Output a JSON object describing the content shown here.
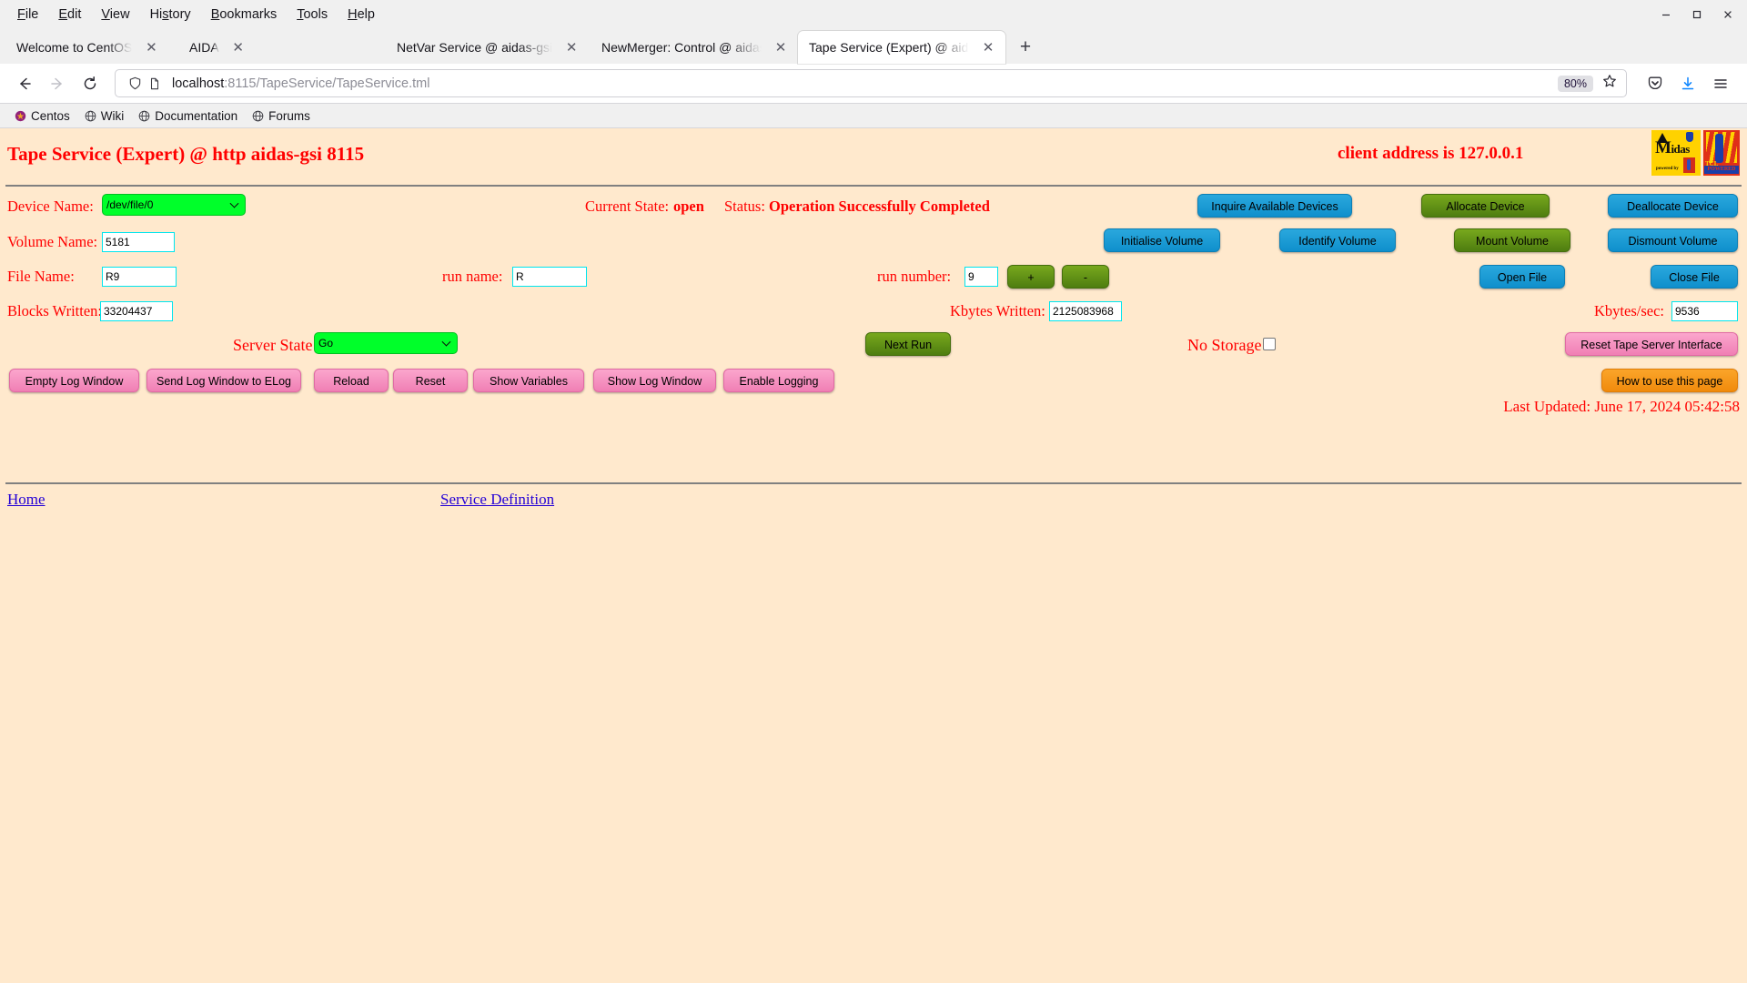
{
  "browser": {
    "menus": [
      {
        "label": "File",
        "accel": "F"
      },
      {
        "label": "Edit",
        "accel": "E"
      },
      {
        "label": "View",
        "accel": "V"
      },
      {
        "label": "History",
        "accel": "s"
      },
      {
        "label": "Bookmarks",
        "accel": "B"
      },
      {
        "label": "Tools",
        "accel": "T"
      },
      {
        "label": "Help",
        "accel": "H"
      }
    ],
    "window_controls": [
      "minimize",
      "maximize",
      "close"
    ],
    "tabs": [
      {
        "label": "Welcome to CentOS",
        "active": false
      },
      {
        "label": "AIDA",
        "active": false
      },
      {
        "label": "NetVar Service @ aidas-gsi",
        "active": false
      },
      {
        "label": "NewMerger: Control @ aidas-gsi",
        "active": false
      },
      {
        "label": "Tape Service (Expert) @ aidas-gsi",
        "active": true
      }
    ],
    "new_tab_label": "+",
    "url_host": "localhost",
    "url_path": ":8115/TapeService/TapeService.tml",
    "zoom_level": "80%",
    "bookmarks": [
      {
        "label": "Centos",
        "icon": "centos-icon"
      },
      {
        "label": "Wiki",
        "icon": "globe-icon"
      },
      {
        "label": "Documentation",
        "icon": "globe-icon"
      },
      {
        "label": "Forums",
        "icon": "globe-icon"
      }
    ]
  },
  "page": {
    "title": "Tape Service (Expert) @ http aidas-gsi 8115",
    "client_address": "client address is 127.0.0.1",
    "logos": {
      "midas": {
        "text": "idas",
        "sub": "powered by"
      },
      "tcl": {
        "text": "TCL",
        "badge": "POWERED"
      }
    },
    "fields": {
      "device_name_label": "Device Name:",
      "device_name_value": "/dev/file/0",
      "volume_name_label": "Volume Name:",
      "volume_name_value": "5181",
      "file_name_label": "File Name:",
      "file_name_value": "R9",
      "run_name_label": "run name:",
      "run_name_value": "R",
      "run_number_label": "run number:",
      "run_number_value": "9",
      "blocks_written_label": "Blocks Written:",
      "blocks_written_value": "33204437",
      "kbytes_written_label": "Kbytes Written:",
      "kbytes_written_value": "2125083968",
      "kbytes_sec_label": "Kbytes/sec:",
      "kbytes_sec_value": "9536",
      "server_state_label": "Server State",
      "server_state_value": "Go",
      "no_storage_label": "No Storage",
      "no_storage_checked": false
    },
    "status": {
      "current_state_label": "Current State:",
      "current_state_value": "open",
      "status_label": "Status:",
      "status_value": "Operation Successfully Completed"
    },
    "buttons": {
      "inquire_available_devices": "Inquire Available Devices",
      "allocate_device": "Allocate Device",
      "deallocate_device": "Deallocate Device",
      "initialise_volume": "Initialise Volume",
      "identify_volume": "Identify Volume",
      "mount_volume": "Mount Volume",
      "dismount_volume": "Dismount Volume",
      "open_file": "Open File",
      "close_file": "Close File",
      "run_plus": "+",
      "run_minus": "-",
      "next_run": "Next Run",
      "reset_tape_server_interface": "Reset Tape Server Interface",
      "empty_log_window": "Empty Log Window",
      "send_log_window_to_elog": "Send Log Window to ELog",
      "reload": "Reload",
      "reset": "Reset",
      "show_variables": "Show Variables",
      "show_log_window": "Show Log Window",
      "enable_logging": "Enable Logging",
      "how_to_use_this_page": "How to use this page"
    },
    "last_updated": "Last Updated: June 17, 2024 05:42:58",
    "footer": {
      "home": "Home",
      "service_definition": "Service Definition"
    }
  }
}
